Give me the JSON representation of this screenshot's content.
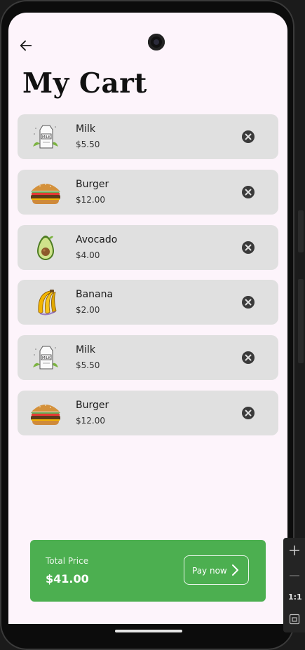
{
  "header": {
    "title": "My Cart",
    "back_icon": "arrow-left-icon"
  },
  "cart": {
    "items": [
      {
        "name": "Milk",
        "price": "$5.50",
        "image": "milk-carton"
      },
      {
        "name": "Burger",
        "price": "$12.00",
        "image": "burger"
      },
      {
        "name": "Avocado",
        "price": "$4.00",
        "image": "avocado"
      },
      {
        "name": "Banana",
        "price": "$2.00",
        "image": "banana"
      },
      {
        "name": "Milk",
        "price": "$5.50",
        "image": "milk-carton"
      },
      {
        "name": "Burger",
        "price": "$12.00",
        "image": "burger"
      }
    ],
    "remove_icon": "close-circle-icon"
  },
  "total": {
    "label": "Total Price",
    "value": "$41.00",
    "pay_label": "Pay now"
  },
  "emulator": {
    "zoom_reset_label": "1:1"
  },
  "colors": {
    "background": "#fdf4fb",
    "item_bg": "#e0e0e0",
    "accent": "#4caf50"
  }
}
